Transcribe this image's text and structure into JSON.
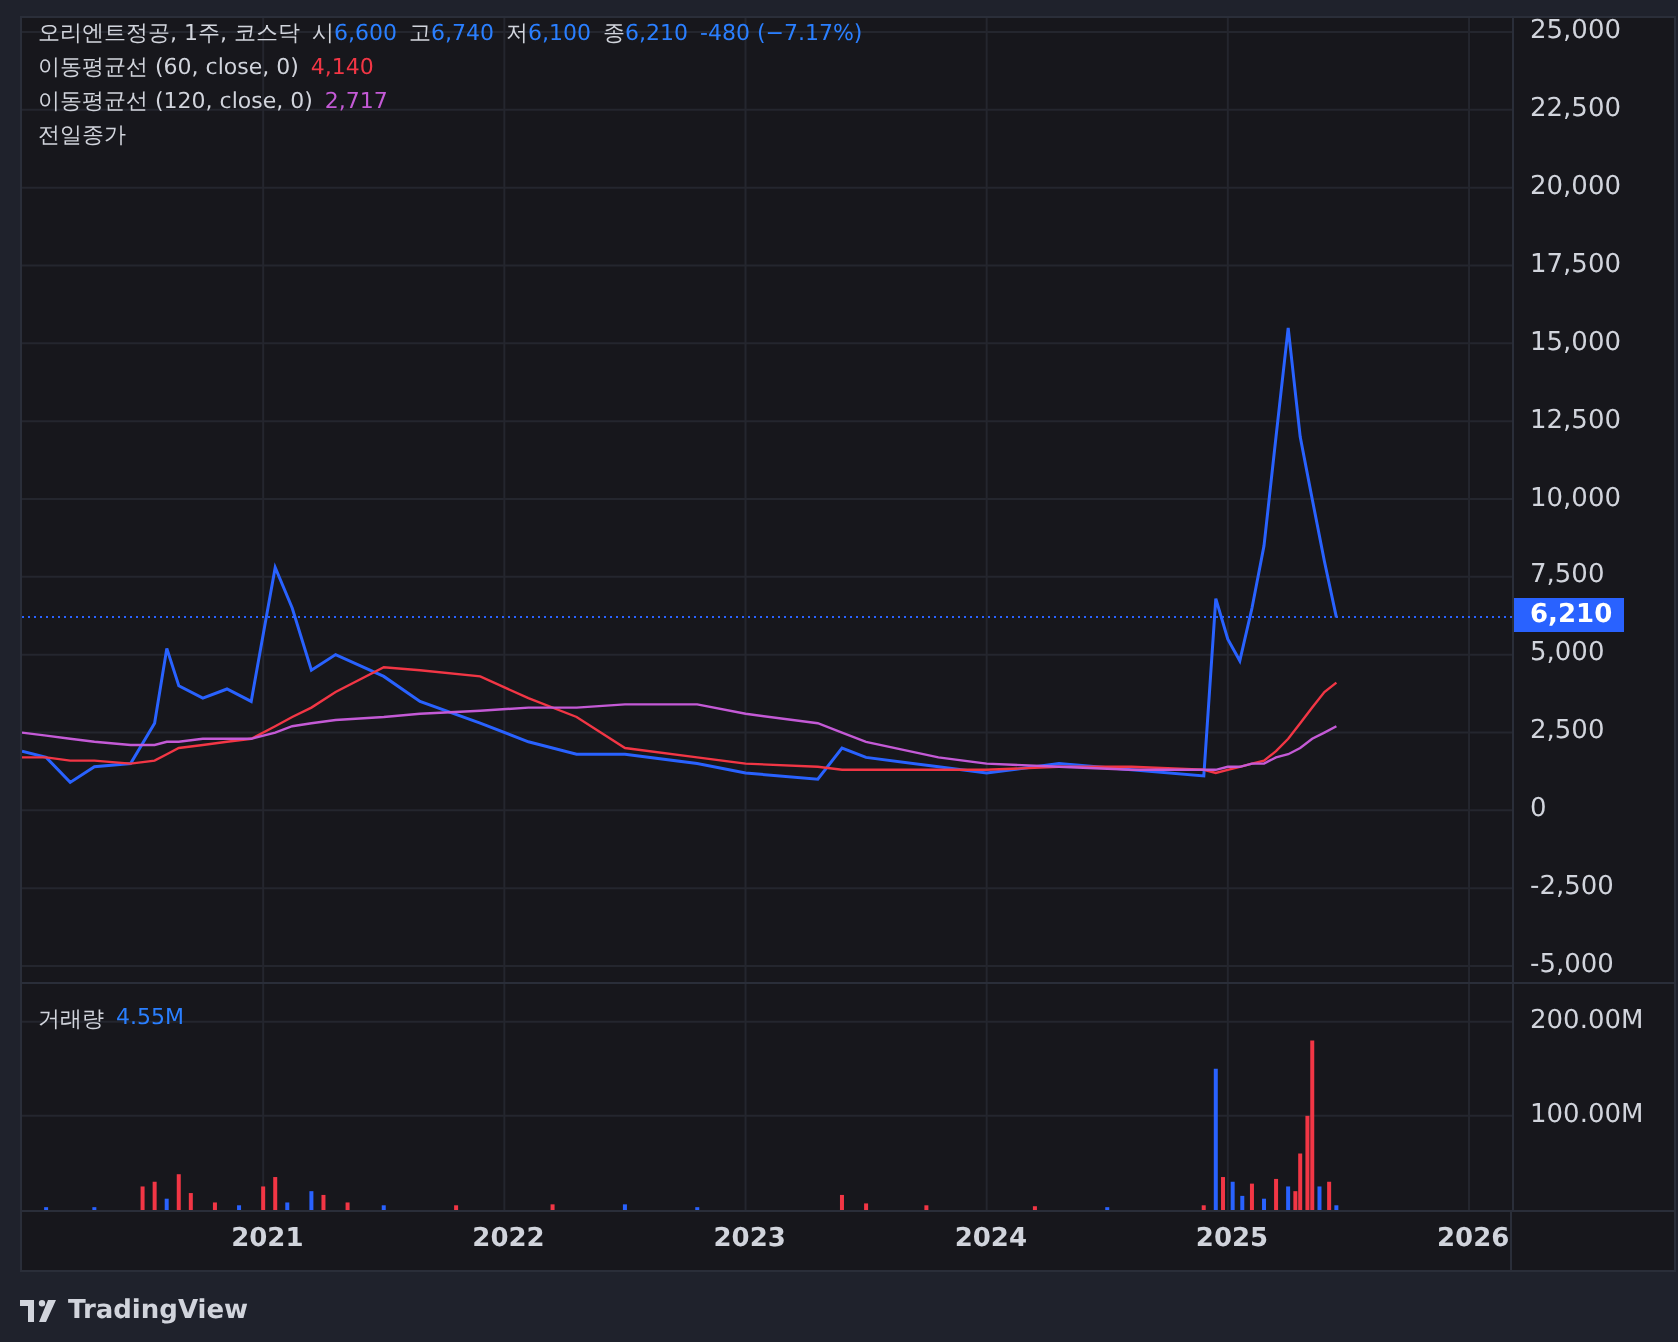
{
  "legend": {
    "symbol": "오리엔트정공, 1주, 코스닥",
    "ohlc": [
      {
        "label": "시",
        "value": "6,600"
      },
      {
        "label": "고",
        "value": "6,740"
      },
      {
        "label": "저",
        "value": "6,100"
      },
      {
        "label": "종",
        "value": "6,210"
      }
    ],
    "change": "-480 (−7.17%)",
    "indicators": [
      {
        "name": "이동평균선 (60, close, 0)",
        "value": "4,140",
        "color": "#f23645"
      },
      {
        "name": "이동평균선 (120, close, 0)",
        "value": "2,717",
        "color": "#c45ad6"
      }
    ],
    "prev_close": "전일종가"
  },
  "price_pane": {
    "last_price": "6,210",
    "chart_data": {
      "type": "line",
      "grid": true,
      "xlim": [
        2020.0,
        2026.85
      ],
      "ylim": [
        -5514,
        25450
      ],
      "yticks": [
        {
          "value": 25000,
          "label": "25,000"
        },
        {
          "value": 22500,
          "label": "22,500"
        },
        {
          "value": 20000,
          "label": "20,000"
        },
        {
          "value": 17500,
          "label": "17,500"
        },
        {
          "value": 15000,
          "label": "15,000"
        },
        {
          "value": 12500,
          "label": "12,500"
        },
        {
          "value": 10000,
          "label": "10,000"
        },
        {
          "value": 7500,
          "label": "7,500"
        },
        {
          "value": 5000,
          "label": "5,000"
        },
        {
          "value": 2500,
          "label": "2,500"
        },
        {
          "value": 0,
          "label": "0"
        },
        {
          "value": -2500,
          "label": "-2,500"
        },
        {
          "value": -5000,
          "label": "-5,000"
        }
      ],
      "x": [
        2020.0,
        2020.1,
        2020.2,
        2020.3,
        2020.45,
        2020.55,
        2020.6,
        2020.65,
        2020.75,
        2020.85,
        2020.95,
        2021.05,
        2021.12,
        2021.2,
        2021.3,
        2021.5,
        2021.65,
        2021.9,
        2022.1,
        2022.3,
        2022.5,
        2022.8,
        2023.0,
        2023.3,
        2023.4,
        2023.5,
        2023.8,
        2024.0,
        2024.3,
        2024.6,
        2024.9,
        2024.95,
        2025.0,
        2025.05,
        2025.1,
        2025.15,
        2025.2,
        2025.25,
        2025.3,
        2025.35,
        2025.4,
        2025.45
      ],
      "series": [
        {
          "color": "#2962ff",
          "values": [
            1900,
            1700,
            900,
            1400,
            1500,
            2800,
            5200,
            4000,
            3600,
            3900,
            3500,
            7800,
            6500,
            4500,
            5000,
            4300,
            3500,
            2800,
            2200,
            1800,
            1800,
            1500,
            1200,
            1000,
            2000,
            1700,
            1400,
            1200,
            1500,
            1300,
            1100,
            6800,
            5500,
            4800,
            6500,
            8500,
            12000,
            15500,
            12000,
            10000,
            8000,
            6200
          ]
        },
        {
          "color": "#f23645",
          "values": [
            1700,
            1700,
            1600,
            1600,
            1500,
            1600,
            1800,
            2000,
            2100,
            2200,
            2300,
            2700,
            3000,
            3300,
            3800,
            4600,
            4500,
            4300,
            3600,
            3000,
            2000,
            1700,
            1500,
            1400,
            1300,
            1300,
            1300,
            1300,
            1400,
            1400,
            1300,
            1200,
            1300,
            1400,
            1500,
            1600,
            1900,
            2300,
            2800,
            3300,
            3800,
            4100
          ]
        },
        {
          "color": "#c45ad6",
          "values": [
            2500,
            2400,
            2300,
            2200,
            2100,
            2100,
            2200,
            2200,
            2300,
            2300,
            2300,
            2500,
            2700,
            2800,
            2900,
            3000,
            3100,
            3200,
            3300,
            3300,
            3400,
            3400,
            3100,
            2800,
            2500,
            2200,
            1700,
            1500,
            1400,
            1300,
            1300,
            1300,
            1400,
            1400,
            1500,
            1500,
            1700,
            1800,
            2000,
            2300,
            2500,
            2700
          ]
        }
      ]
    }
  },
  "volume_pane": {
    "label": "거래량",
    "value": "4.55M",
    "chart_data": {
      "type": "bar",
      "grid": true,
      "xlim": [
        2020.0,
        2026.85
      ],
      "ylim": [
        0,
        240
      ],
      "yticks": [
        {
          "value": 100,
          "label": "100.00M"
        },
        {
          "value": 200,
          "label": "200.00M"
        }
      ],
      "xticks": [
        {
          "value": 2021,
          "label": "2021"
        },
        {
          "value": 2022,
          "label": "2022"
        },
        {
          "value": 2023,
          "label": "2023"
        },
        {
          "value": 2024,
          "label": "2024"
        },
        {
          "value": 2025,
          "label": "2025"
        },
        {
          "value": 2026,
          "label": "2026"
        }
      ],
      "x": [
        2020.1,
        2020.3,
        2020.5,
        2020.55,
        2020.6,
        2020.65,
        2020.7,
        2020.8,
        2020.9,
        2021.0,
        2021.05,
        2021.1,
        2021.2,
        2021.25,
        2021.35,
        2021.5,
        2021.8,
        2022.2,
        2022.5,
        2022.8,
        2023.4,
        2023.5,
        2023.75,
        2024.2,
        2024.5,
        2024.9,
        2024.95,
        2024.98,
        2025.02,
        2025.06,
        2025.1,
        2025.15,
        2025.2,
        2025.25,
        2025.28,
        2025.3,
        2025.33,
        2025.35,
        2025.38,
        2025.42,
        2025.45
      ],
      "series": [
        {
          "color": "#f23645",
          "values": [
            null,
            null,
            25,
            30,
            null,
            38,
            18,
            8,
            null,
            25,
            35,
            null,
            null,
            16,
            8,
            null,
            5,
            6,
            null,
            null,
            16,
            7,
            5,
            4,
            null,
            5,
            null,
            35,
            null,
            null,
            28,
            null,
            33,
            null,
            20,
            60,
            100,
            180,
            null,
            30,
            null
          ]
        },
        {
          "color": "#2962ff",
          "values": [
            3,
            3,
            null,
            null,
            12,
            null,
            null,
            null,
            5,
            null,
            null,
            8,
            20,
            null,
            null,
            5,
            null,
            null,
            6,
            3,
            null,
            null,
            null,
            null,
            3,
            null,
            150,
            null,
            30,
            15,
            null,
            12,
            null,
            25,
            null,
            null,
            null,
            null,
            25,
            null,
            5
          ]
        }
      ]
    }
  },
  "footer": {
    "brand": "TradingView"
  }
}
